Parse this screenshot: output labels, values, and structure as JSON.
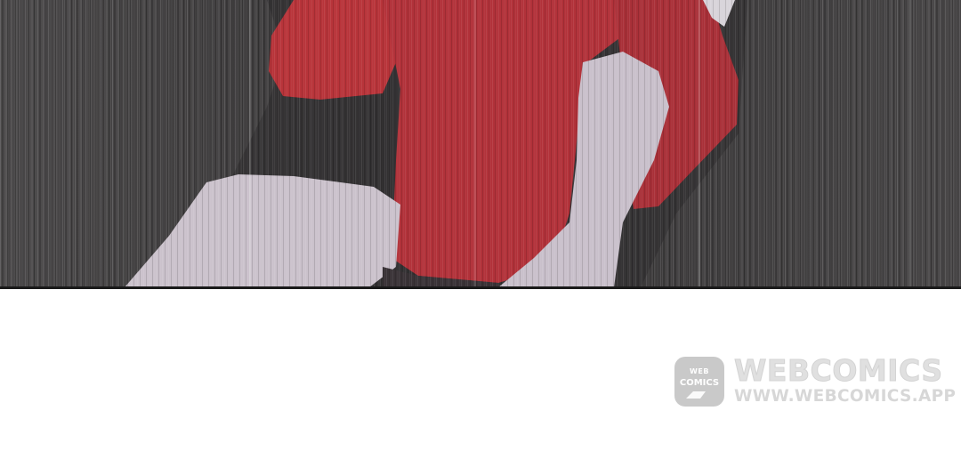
{
  "panel": {
    "scene": "comic-panel-figure-in-red-jacket-kneeling",
    "background_color": "#434142",
    "jacket_color": "#b8343a",
    "pants_color": "#cbc2cc",
    "border_color": "#1a1a1a"
  },
  "watermark": {
    "logo_top": "WEB",
    "logo_bottom": "COMICS",
    "title": "WEBCOMICS",
    "url": "WWW.WEBCOMICS.APP",
    "color": "#b0b0b0"
  }
}
